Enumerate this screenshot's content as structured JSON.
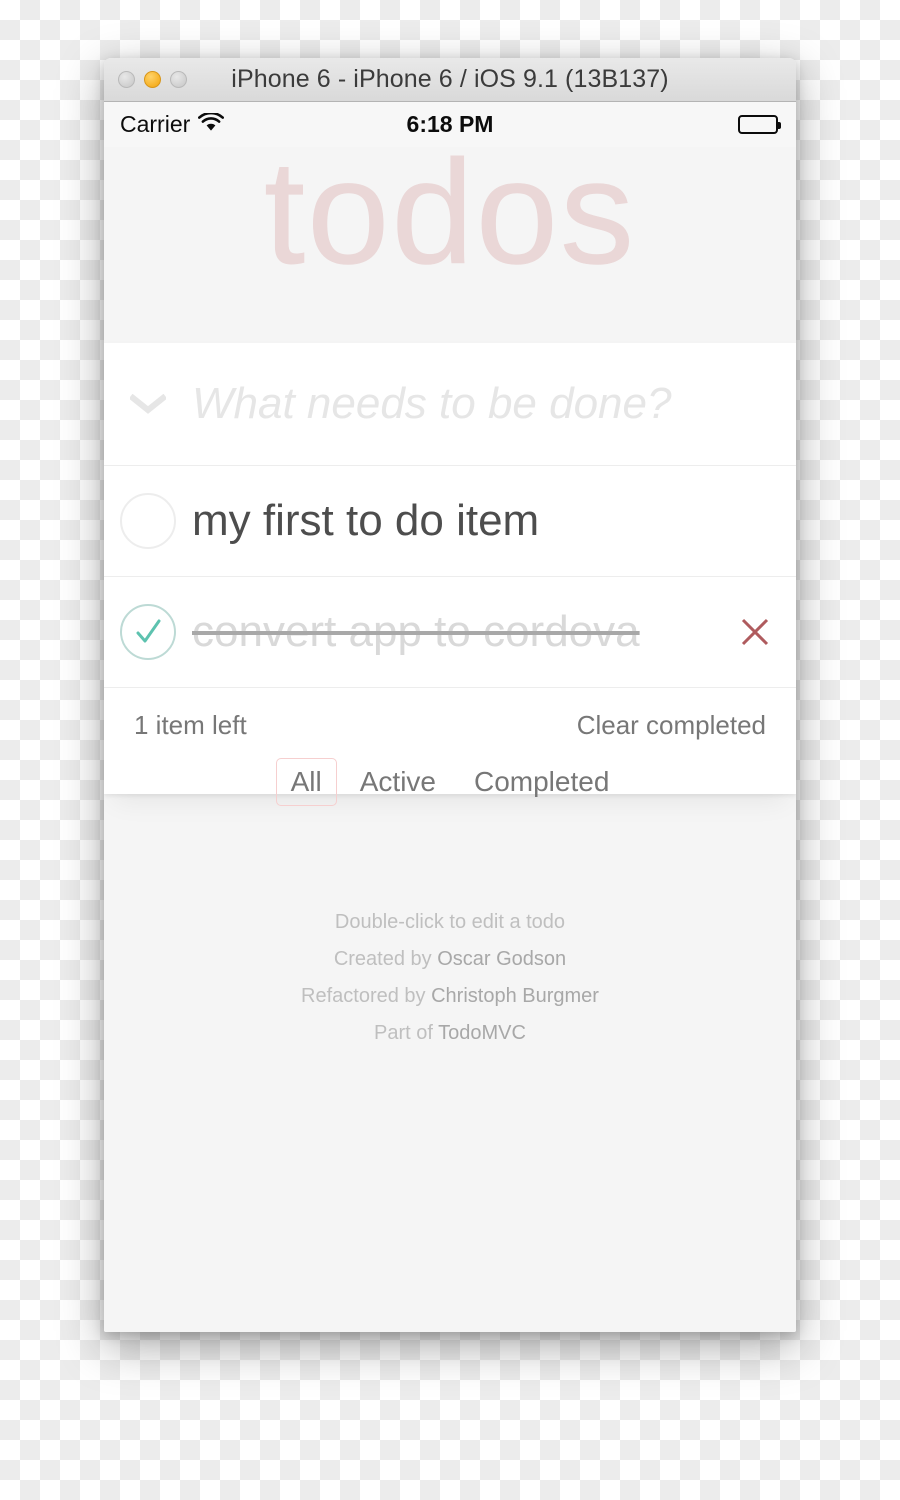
{
  "window": {
    "title": "iPhone 6 - iPhone 6 / iOS 9.1 (13B137)",
    "buttons": {
      "close": "close",
      "minimize": "minimize",
      "zoom": "zoom"
    }
  },
  "status_bar": {
    "carrier": "Carrier",
    "wifi_icon": "wifi-icon",
    "time": "6:18 PM",
    "battery_icon": "battery-full-icon"
  },
  "app": {
    "title": "todos",
    "toggle_all_icon": "chevron-down-icon",
    "new_todo": {
      "value": "",
      "placeholder": "What needs to be done?"
    },
    "todos": [
      {
        "label": "my first to do item",
        "completed": false,
        "toggle_icon": "circle-icon",
        "destroy_icon": ""
      },
      {
        "label": "convert app to cordova",
        "completed": true,
        "toggle_icon": "check-circle-icon",
        "destroy_icon": "close-x-icon"
      }
    ],
    "footer": {
      "count_text": "1 item left",
      "clear_completed": "Clear completed",
      "filters": [
        {
          "label": "All",
          "selected": true
        },
        {
          "label": "Active",
          "selected": false
        },
        {
          "label": "Completed",
          "selected": false
        }
      ]
    }
  },
  "info": {
    "line1": "Double-click to edit a todo",
    "line2_prefix": "Created by ",
    "line2_link": "Oscar Godson",
    "line3_prefix": "Refactored by ",
    "line3_link": "Christoph Burgmer",
    "line4_prefix": "Part of ",
    "line4_link": "TodoMVC"
  },
  "colors": {
    "accent_title": "#ead7d7",
    "filter_selected_border": "#f6cfcf",
    "destroy": "#af5b5e",
    "check": "#5dc2af",
    "check_border": "#bddad5",
    "minimize_button": "#f6b024"
  }
}
